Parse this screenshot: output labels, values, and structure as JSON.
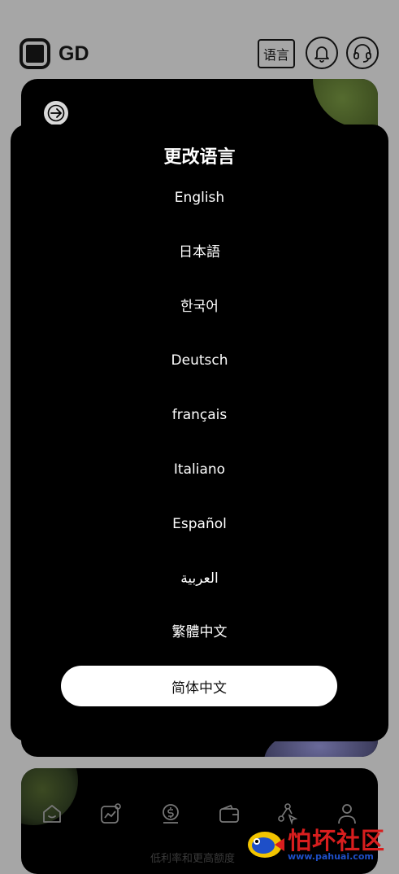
{
  "header": {
    "brand": "GD",
    "language_button": "语言"
  },
  "modal": {
    "title": "更改语言",
    "languages": [
      "English",
      "日本語",
      "한국어",
      "Deutsch",
      "français",
      "Italiano",
      "Español",
      "العربية",
      "繁體中文"
    ],
    "selected": "简体中文"
  },
  "footer": {
    "text": "低利率和更高额度"
  },
  "watermark": {
    "title": "怕坏社区",
    "url": "www.pahuai.com"
  },
  "icons": {
    "logo": "logo-icon",
    "bell": "bell-icon",
    "support": "headset-icon",
    "back": "arrow-right-icon",
    "nav": [
      "home-icon",
      "chart-icon",
      "dollar-icon",
      "wallet-icon",
      "share-icon",
      "user-icon"
    ]
  },
  "colors": {
    "page_bg": "#a6a6a6",
    "card_bg": "#000000",
    "selected_bg": "#ffffff",
    "watermark_red": "#d81e1e",
    "watermark_blue": "#1e4fc8"
  }
}
